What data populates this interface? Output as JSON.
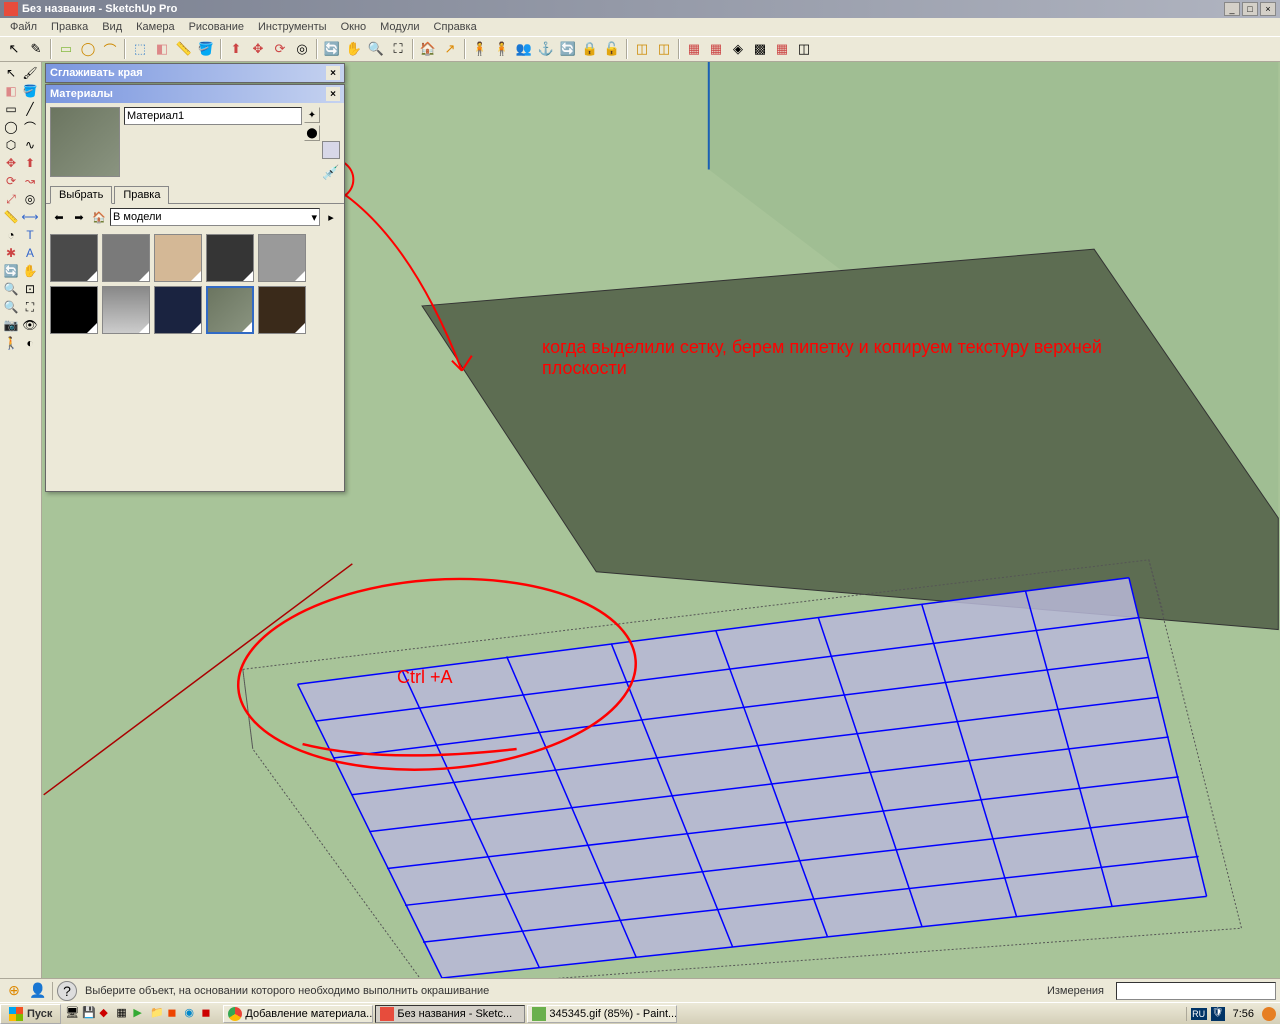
{
  "window": {
    "title": "Без названия - SketchUp Pro",
    "min": "_",
    "max": "□",
    "close": "×"
  },
  "menu": {
    "file": "Файл",
    "edit": "Правка",
    "view": "Вид",
    "camera": "Камера",
    "draw": "Рисование",
    "tools": "Инструменты",
    "window": "Окно",
    "plugins": "Модули",
    "help": "Справка"
  },
  "panels": {
    "smooth": {
      "title": "Сглаживать края"
    },
    "materials": {
      "title": "Материалы",
      "name": "Материал1",
      "tabs": {
        "select": "Выбрать",
        "edit": "Правка"
      },
      "location": "В модели"
    }
  },
  "status": {
    "hint": "Выберите объект, на основании которого необходимо выполнить окрашивание",
    "measurements_label": "Измерения"
  },
  "taskbar": {
    "start": "Пуск",
    "items": [
      {
        "label": "Добавление материала..."
      },
      {
        "label": "Без названия - Sketc..."
      },
      {
        "label": "345345.gif (85%) - Paint..."
      }
    ],
    "lang": "RU",
    "time": "7:56"
  },
  "annotations": {
    "main": "когда выделили сетку, берем пипетку и копируем текстуру верхней плоскости",
    "shortcut": "Ctrl +A"
  }
}
